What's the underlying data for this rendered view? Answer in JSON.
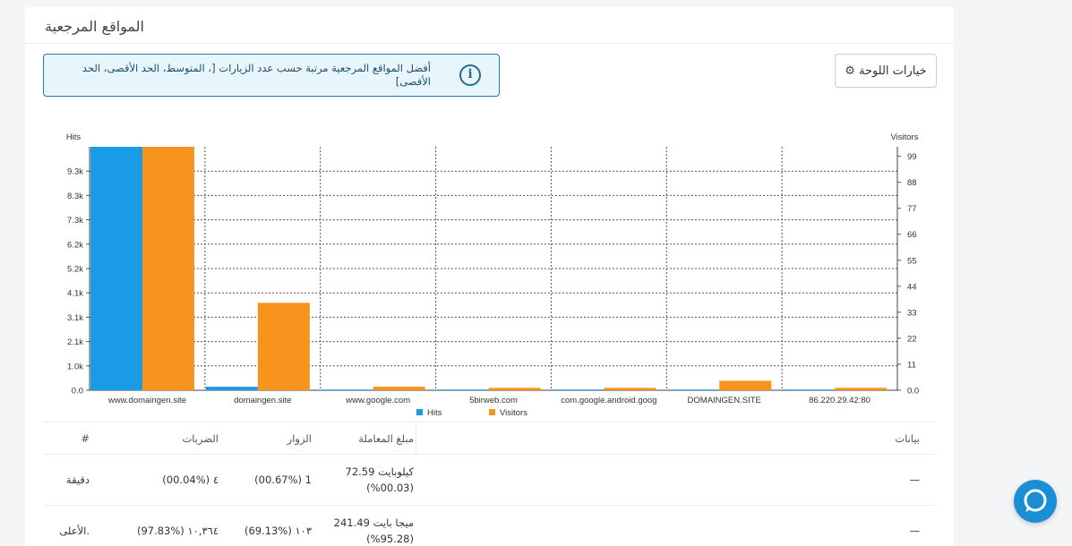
{
  "panel": {
    "title": "المواقع المرجعية",
    "options_label": "خيارات اللوحة"
  },
  "info": {
    "text": "أفضل المواقع المرجعية مرتبة حسب عدد الزيارات [، المتوسط، الحد الأقصى، الحد الأقصى]"
  },
  "chart_data": {
    "type": "bar",
    "categories": [
      "www.domaingen.site",
      "domaingen.site",
      "www.google.com",
      "5birweb.com",
      "com.google.android.goog",
      "DOMAINGEN.SITE",
      "86.220.29.42:80"
    ],
    "series": [
      {
        "name": "Hits",
        "axis": "left",
        "color": "#1a9be6",
        "values": [
          10364,
          150,
          20,
          5,
          10,
          8,
          5
        ]
      },
      {
        "name": "Visitors",
        "axis": "right",
        "color": "#f7941d",
        "values": [
          103,
          37,
          1.5,
          1,
          1,
          4,
          1
        ]
      }
    ],
    "left_axis": {
      "label": "Hits",
      "ticks": [
        "0.0",
        "1.0k",
        "2.1k",
        "3.1k",
        "4.1k",
        "5.2k",
        "6.2k",
        "7.3k",
        "8.3k",
        "9.3k"
      ],
      "max": 10364
    },
    "right_axis": {
      "label": "Visitors",
      "ticks": [
        "0.0",
        "11",
        "22",
        "33",
        "44",
        "55",
        "66",
        "77",
        "88",
        "99"
      ],
      "max": 103
    },
    "legend": [
      "Hits",
      "Visitors"
    ],
    "legend_position": "bottom"
  },
  "table": {
    "headers": {
      "data": "بيانات",
      "amount": "مبلغ المعاملة",
      "visitors": "الزوار",
      "hits": "الضربات",
      "num": "#"
    },
    "rows": [
      {
        "data": "—",
        "amount_1": "كيلوبايت 72.59",
        "amount_2": "(%00.03)",
        "visitors": "1 (00.67%)",
        "hits": "٤ (00.04%)",
        "num": "دقيقة"
      },
      {
        "data": "—",
        "amount_1": "ميجا بايت 241.49",
        "amount_2": "(%95.28)",
        "visitors": "١٠٣ (69.13%)",
        "hits": "١٠,٣٦٤ (97.83%)",
        "num": ".الأعلى"
      }
    ]
  }
}
